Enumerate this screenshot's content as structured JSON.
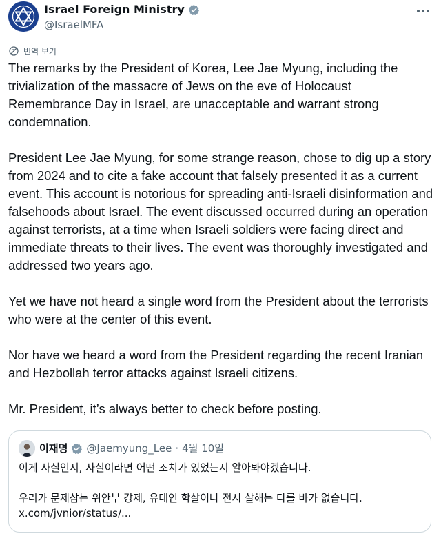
{
  "post": {
    "author_name": "Israel Foreign Ministry",
    "author_handle": "@IsraelMFA",
    "translate_label": "번역 보기",
    "paragraphs": [
      "The remarks by the President of Korea, Lee Jae Myung, including the trivialization of the massacre of Jews on the eve of Holocaust Remembrance Day in Israel, are unacceptable and warrant strong condemnation.",
      "President Lee Jae Myung, for some strange reason, chose to dig up a story from 2024 and to cite a fake account that falsely presented it as a current event. This account is notorious for spreading anti-Israeli disinformation and falsehoods about Israel. The event discussed occurred during an operation against terrorists, at a time when Israeli soldiers were facing direct and immediate threats to their lives. The event was thoroughly investigated and addressed two years ago.",
      "Yet we have not heard a single word from the President about the terrorists who were at the center of this event.",
      "Nor have we heard a word from the President regarding the recent Iranian and Hezbollah terror attacks against Israeli citizens.",
      "Mr. President, it’s always better to check before posting."
    ]
  },
  "quote": {
    "author_name": "이재명",
    "author_handle": "@Jaemyung_Lee",
    "separator": "·",
    "date": "4월 10일",
    "line1": "이게 사실인지, 사실이라면 어떤 조치가 있었는지 알아봐야겠습니다.",
    "line2": "우리가 문제삼는 위안부 강제, 유태인 학살이나 전시 살해는 다를 바가 없습니다.",
    "link": "x.com/jvnior/status/..."
  },
  "icons": {
    "verified": "verified-badge-icon",
    "more": "more-options-icon",
    "translate": "globe-translate-icon"
  },
  "colors": {
    "verified_blue": "#1d9bf0",
    "text": "#0f1419",
    "secondary_text": "#536471",
    "border": "#cfd9de",
    "logo_navy": "#1a3f8f"
  }
}
